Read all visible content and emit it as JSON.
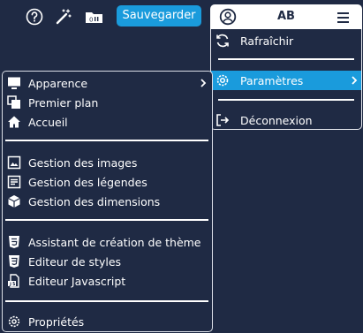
{
  "toolbar": {
    "save_label": "Sauvegarder",
    "icons": [
      "help-icon",
      "magic-wand-icon",
      "folder-io-icon"
    ]
  },
  "user": {
    "initials": "AB",
    "icons": [
      "user-circle-icon",
      "hamburger-menu-icon"
    ]
  },
  "user_menu": {
    "items": [
      {
        "label": "Rafraîchir",
        "icon": "refresh-icon"
      },
      {
        "label": "Paramètres",
        "icon": "gear-icon",
        "active": true,
        "submenu": true
      },
      {
        "label": "Déconnexion",
        "icon": "logout-icon"
      }
    ]
  },
  "settings_menu": {
    "groups": [
      [
        {
          "label": "Apparence",
          "icon": "monitor-icon",
          "submenu": true
        },
        {
          "label": "Premier plan",
          "icon": "foreground-icon"
        },
        {
          "label": "Accueil",
          "icon": "home-icon"
        }
      ],
      [
        {
          "label": "Gestion des images",
          "icon": "image-icon"
        },
        {
          "label": "Gestion des légendes",
          "icon": "caption-icon"
        },
        {
          "label": "Gestion des dimensions",
          "icon": "cube-icon"
        }
      ],
      [
        {
          "label": "Assistant de création de thème",
          "icon": "html5-icon"
        },
        {
          "label": "Editeur de styles",
          "icon": "css3-icon"
        },
        {
          "label": "Editeur Javascript",
          "icon": "js-file-icon"
        }
      ],
      [
        {
          "label": "Propriétés",
          "icon": "settings-icon"
        }
      ]
    ]
  },
  "colors": {
    "background": "#1f2a44",
    "accent": "#1a9bdc",
    "text": "#ffffff"
  }
}
